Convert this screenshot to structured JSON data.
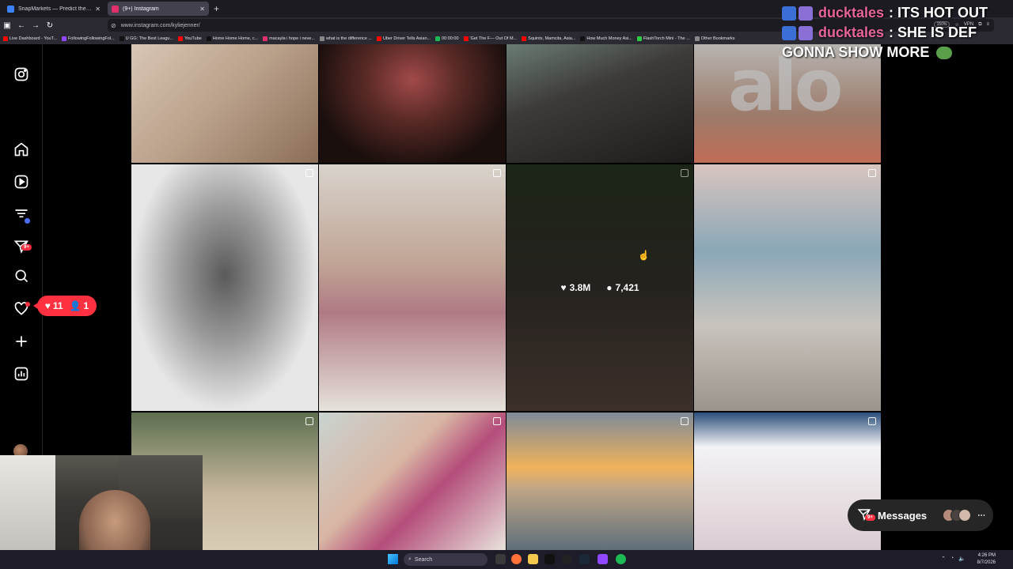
{
  "browser": {
    "tabs": [
      {
        "title": "SnapMarkets — Predict the Ne",
        "favicon_color": "#3b82f6",
        "active": false
      },
      {
        "title": "(9+) Instagram",
        "favicon_color": "#e1306c",
        "active": true
      }
    ],
    "url": "www.instagram.com/kyliejenner/",
    "zoom": "150%",
    "vpn": "VPN",
    "bookmarks": [
      {
        "label": "Live Dashboard - YouT...",
        "color": "#ff0000"
      },
      {
        "label": "FollowingFollowingFol...",
        "color": "#9146ff"
      },
      {
        "label": "U GG: The Best Leagu...",
        "color": "#111111"
      },
      {
        "label": "YouTube",
        "color": "#ff0000"
      },
      {
        "label": "Home Home Home, c...",
        "color": "#111111"
      },
      {
        "label": "macayla i hope i neve...",
        "color": "#e1306c"
      },
      {
        "label": "what is the difference ...",
        "color": "#888888"
      },
      {
        "label": "Uber Driver Tells Asian...",
        "color": "#ff0000"
      },
      {
        "label": "00:00:00",
        "color": "#1db954"
      },
      {
        "label": "'Get The F— Out Of M...",
        "color": "#ff0000"
      },
      {
        "label": "Squints, Mamcita, Asia...",
        "color": "#ff0000"
      },
      {
        "label": "How Much Money Asi...",
        "color": "#111111"
      },
      {
        "label": "FlashTorch Mini - The ...",
        "color": "#2ecc40"
      },
      {
        "label": "Other Bookmarks",
        "color": "#888888"
      }
    ]
  },
  "sidebar": {
    "messages_badge": "9+",
    "notif_likes": "11",
    "notif_follows": "1"
  },
  "grid": {
    "hover_likes": "3.8M",
    "hover_comments": "7,421",
    "watermark": "alo"
  },
  "chat": [
    {
      "user": "ducktales",
      "message": ": ITS HOT OUT"
    },
    {
      "user": "ducktales",
      "message": ": SHE IS DEF"
    }
  ],
  "chat_continuation": "GONNA SHOW MORE",
  "messages": {
    "label": "Messages",
    "badge": "9+"
  },
  "taskbar": {
    "search_placeholder": "Search",
    "time": "4:26 PM",
    "date": "8/7/2026"
  }
}
